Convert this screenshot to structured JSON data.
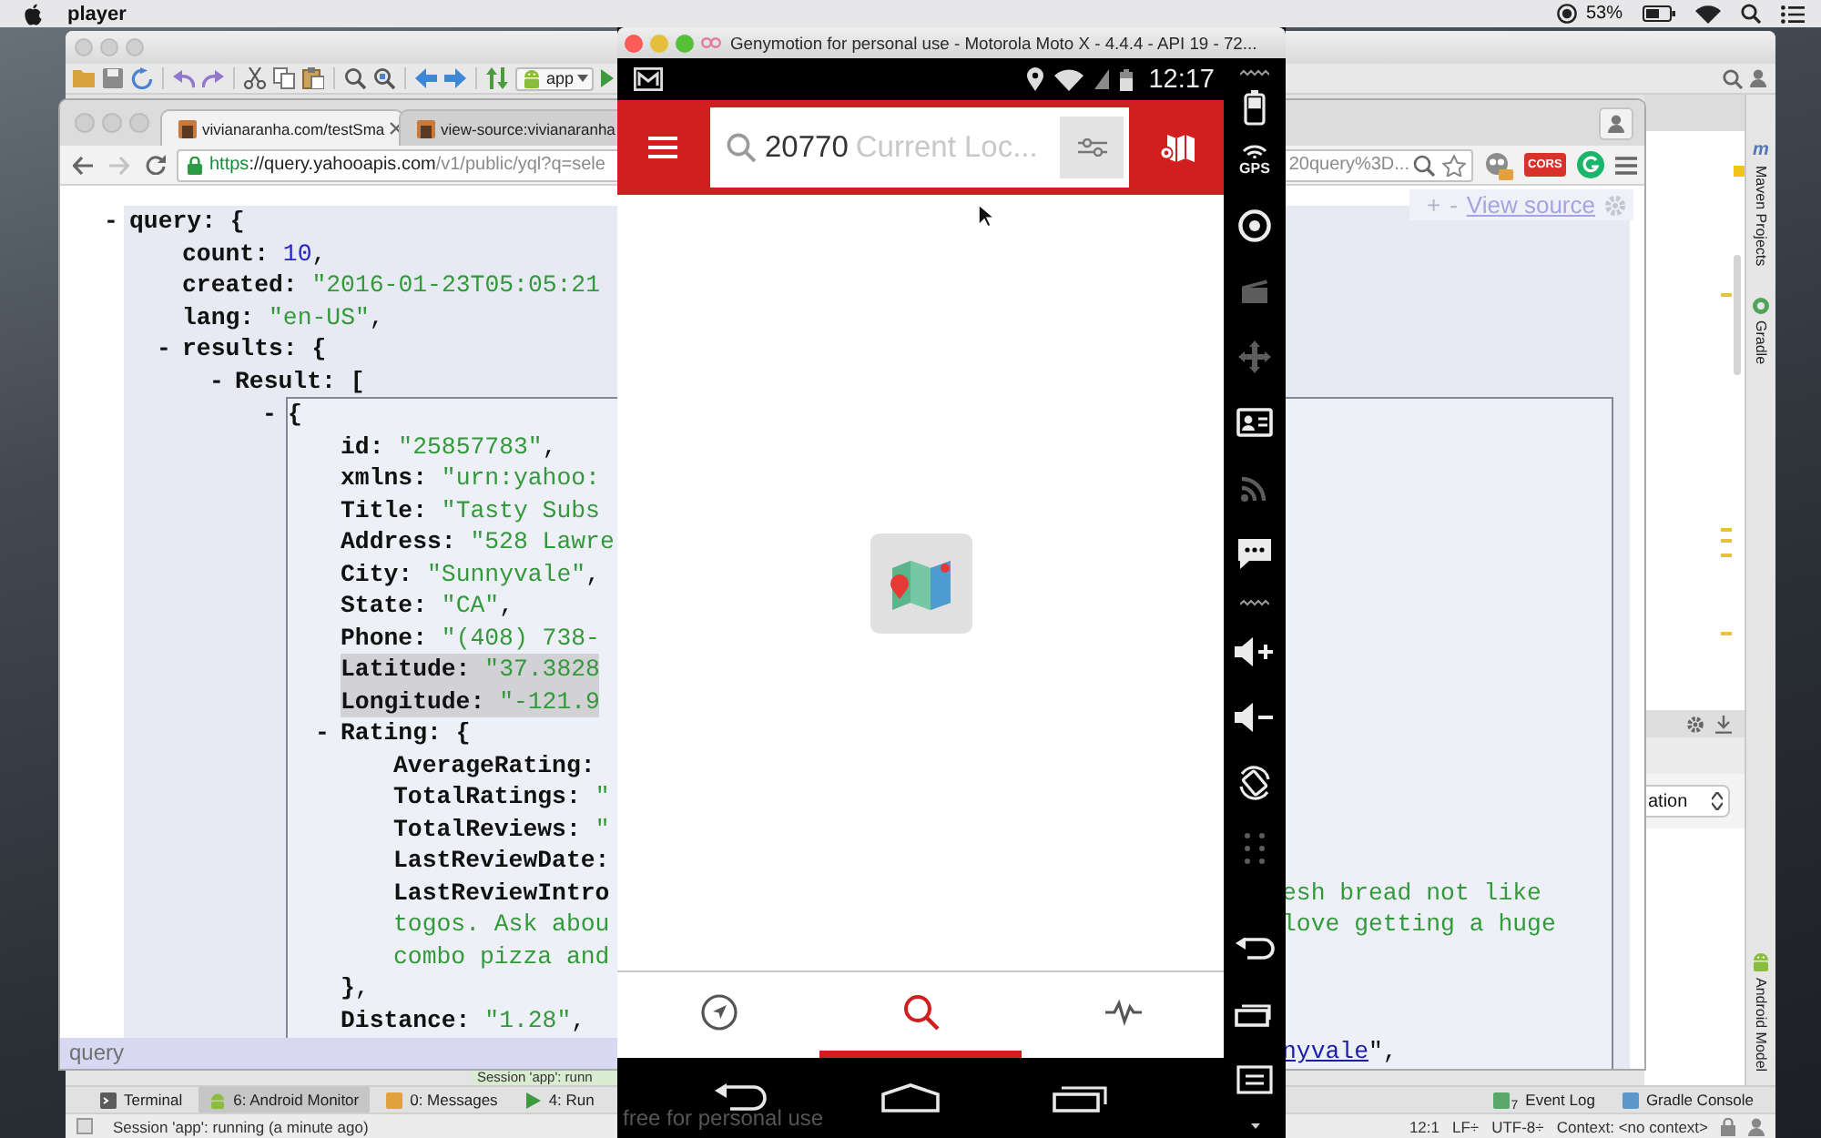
{
  "menu_bar": {
    "app_name": "player",
    "battery_percent": "53%"
  },
  "ide": {
    "run_config": "app",
    "side_tabs": [
      {
        "label": "Maven Projects",
        "kind": "maven",
        "glyph": "m"
      },
      {
        "label": "Gradle",
        "kind": "gradle"
      },
      {
        "label": "Android Model",
        "kind": "android"
      }
    ],
    "panel_dropdown": "ation",
    "notification": "Session 'app': runn",
    "tool_tabs_left": [
      {
        "label": "Terminal",
        "kind": "terminal",
        "selected": false
      },
      {
        "label": "6: Android Monitor",
        "kind": "android",
        "selected": true
      },
      {
        "label": "0: Messages",
        "kind": "messages",
        "selected": false
      },
      {
        "label": "4: Run",
        "kind": "run",
        "selected": false
      }
    ],
    "tool_tabs_right": [
      {
        "label": "Event Log",
        "badge": "7",
        "kind": "log",
        "selected": false
      },
      {
        "label": "Gradle Console",
        "kind": "console",
        "selected": false
      }
    ],
    "status_bar": {
      "message": "Session 'app': running (a minute ago)",
      "position": "12:1",
      "line_separator": "LF÷",
      "encoding": "UTF-8÷",
      "context": "Context: <no context>"
    }
  },
  "browser": {
    "tabs": [
      {
        "title": "vivianaranha.com/testSma",
        "selected": true,
        "closable": true
      },
      {
        "title": "view-source:vivianaranha",
        "selected": false,
        "closable": false
      }
    ],
    "back_disabled": false,
    "forward_disabled": true,
    "url": {
      "scheme": "https",
      "host": "://query.yahooapis.com",
      "path": "/v1/public/yql?q=sele",
      "tail": "20query%3D..."
    },
    "extensions": [
      {
        "kind": "owl"
      },
      {
        "kind": "cors",
        "label": "CORS"
      },
      {
        "kind": "grammarly"
      }
    ],
    "viewer_toolbar": {
      "expand": "+",
      "collapse": "-",
      "link": "View source"
    },
    "code": [
      {
        "toggle": "-",
        "key": "query:",
        "value": "{",
        "kind": "punct",
        "shaded": true,
        "children": [
          {
            "key": "count:",
            "value": "10",
            "kind": "number",
            "after": ","
          },
          {
            "key": "created:",
            "value": "\"2016-01-23T05:05:21",
            "kind": "string"
          },
          {
            "key": "lang:",
            "value": "\"en-US\"",
            "kind": "string",
            "after": ","
          },
          {
            "toggle": "-",
            "key": "results:",
            "value": "{",
            "kind": "punct",
            "children": [
              {
                "toggle": "-",
                "key": "Result:",
                "value": "[",
                "kind": "punct",
                "children": [
                  {
                    "toggle": "-",
                    "value": "{",
                    "kind": "punct",
                    "outlined": true,
                    "children": [
                      {
                        "key": "id:",
                        "value": "\"25857783\"",
                        "kind": "string",
                        "after": ","
                      },
                      {
                        "key": "xmlns:",
                        "value": "\"urn:yahoo:",
                        "kind": "string"
                      },
                      {
                        "key": "Title:",
                        "value": "\"Tasty Subs",
                        "kind": "string"
                      },
                      {
                        "key": "Address:",
                        "value": "\"528 Lawre",
                        "kind": "string"
                      },
                      {
                        "key": "City:",
                        "value": "\"Sunnyvale\"",
                        "kind": "string",
                        "after": ","
                      },
                      {
                        "key": "State:",
                        "value": "\"CA\"",
                        "kind": "string",
                        "after": ","
                      },
                      {
                        "key": "Phone:",
                        "value": "\"(408) 738-",
                        "kind": "string"
                      },
                      {
                        "key": "Latitude:",
                        "value": "\"37.3828",
                        "kind": "string",
                        "highlighted": true
                      },
                      {
                        "key": "Longitude:",
                        "value": "\"-121.9",
                        "kind": "string",
                        "highlighted": true
                      },
                      {
                        "toggle": "-",
                        "key": "Rating:",
                        "value": "{",
                        "kind": "punct",
                        "children": [
                          {
                            "key": "AverageRating:"
                          },
                          {
                            "key": "TotalRatings:",
                            "value": "\"",
                            "kind": "string"
                          },
                          {
                            "key": "TotalReviews:",
                            "value": "\"",
                            "kind": "string"
                          },
                          {
                            "key": "LastReviewDate:"
                          },
                          {
                            "key": "LastReviewIntro",
                            "right": {
                              "text": "esh bread not like",
                              "kind": "string"
                            }
                          },
                          {
                            "value": "togos. Ask abou",
                            "kind": "string",
                            "right": {
                              "text": "love getting a huge",
                              "kind": "string"
                            }
                          },
                          {
                            "value": "combo pizza and",
                            "kind": "string"
                          }
                        ]
                      },
                      {
                        "value": "}",
                        "kind": "punct",
                        "after": ","
                      },
                      {
                        "key": "Distance:",
                        "value": "\"1.28\"",
                        "kind": "string",
                        "after": ","
                      },
                      {
                        "right": {
                          "link": "nyvale",
                          "text": "\","
                        }
                      }
                    ]
                  }
                ]
              }
            ]
          }
        ]
      }
    ],
    "find_bar": "query"
  },
  "phone": {
    "window_title": "Genymotion for personal use - Motorola Moto X - 4.4.4 - API 19 - 72...",
    "clock": "12:17",
    "search": {
      "value": "20770",
      "location_label": "Current Loc..."
    },
    "bottom_tabs": [
      {
        "kind": "navigate",
        "selected": false
      },
      {
        "kind": "search",
        "selected": true
      },
      {
        "kind": "activity",
        "selected": false
      }
    ],
    "overlay_notice": "free for personal use",
    "toolbar": {
      "top": [
        {
          "kind": "battery",
          "disabled": false
        },
        {
          "kind": "gps",
          "label": "GPS",
          "disabled": false
        },
        {
          "kind": "webcam",
          "disabled": false
        },
        {
          "kind": "video",
          "disabled": true
        },
        {
          "kind": "dpad",
          "disabled": true
        },
        {
          "kind": "id",
          "disabled": false
        },
        {
          "kind": "remote",
          "disabled": true
        },
        {
          "kind": "sms",
          "disabled": false
        }
      ],
      "middle": [
        {
          "kind": "volume_up",
          "disabled": false
        },
        {
          "kind": "volume_down",
          "disabled": false
        },
        {
          "kind": "rotate",
          "disabled": false
        },
        {
          "kind": "more",
          "disabled": true
        }
      ],
      "bottom": [
        {
          "kind": "back",
          "disabled": false
        },
        {
          "kind": "recents",
          "disabled": false
        },
        {
          "kind": "menu",
          "disabled": false
        }
      ]
    }
  }
}
